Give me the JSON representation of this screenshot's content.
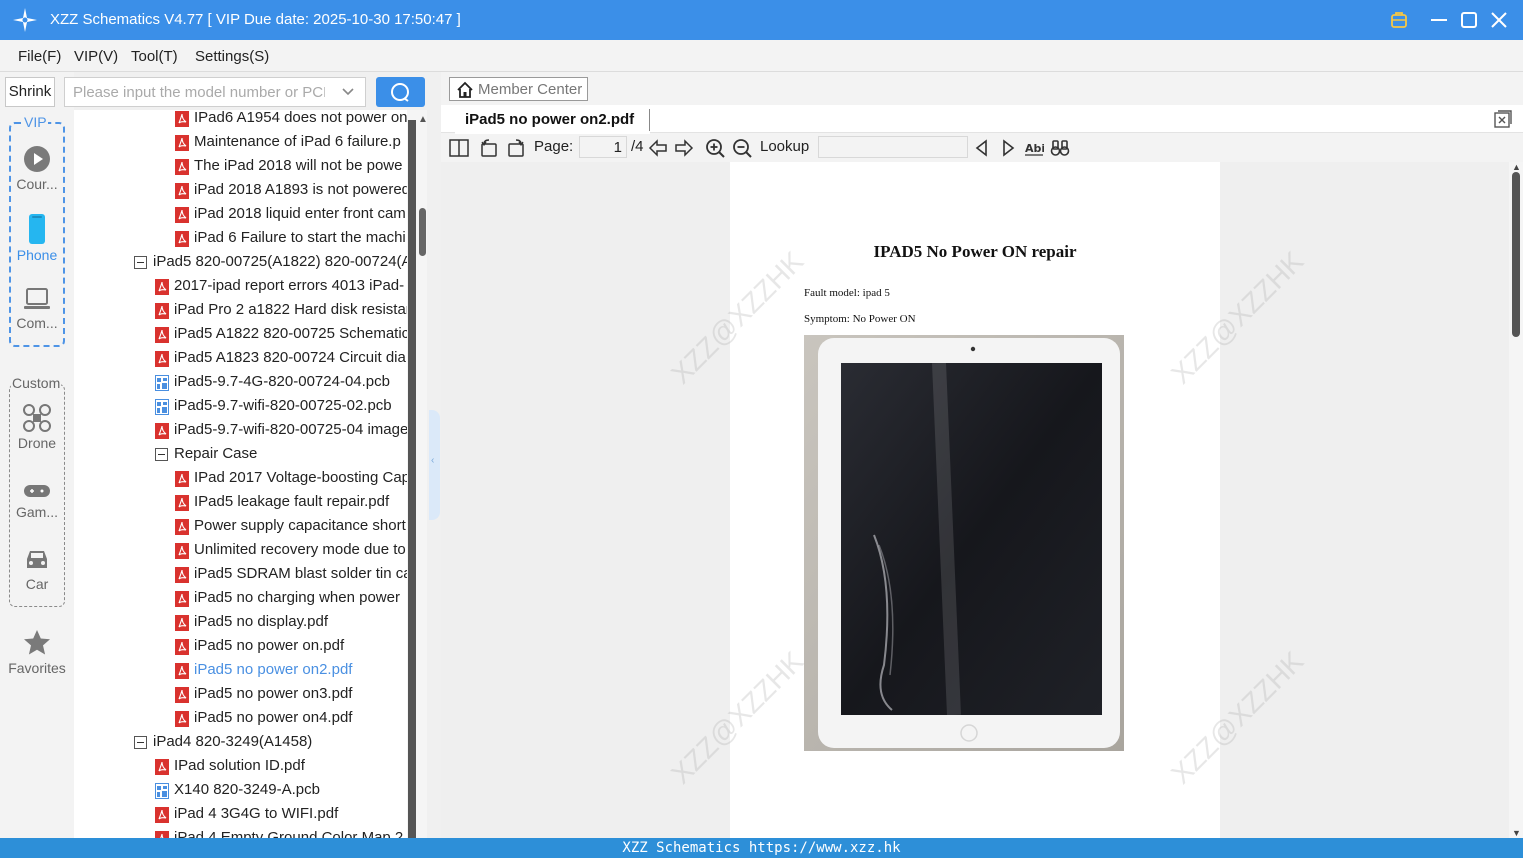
{
  "window": {
    "title": "XZZ Schematics V4.77 [ VIP Due date: 2025-10-30 17:50:47 ]"
  },
  "menu": [
    "File(F)",
    "VIP(V)",
    "Tool(T)",
    "Settings(S)"
  ],
  "left": {
    "shrink_label": "Shrink",
    "vip_label": "VIP",
    "custom_label": "Custom",
    "vip_items": [
      {
        "label": "Cour...",
        "icon": "play-icon"
      },
      {
        "label": "Phone",
        "icon": "phone-icon"
      },
      {
        "label": "Com...",
        "icon": "laptop-icon"
      }
    ],
    "custom_items": [
      {
        "label": "Drone",
        "icon": "drone-icon"
      },
      {
        "label": "Gam...",
        "icon": "gamepad-icon"
      },
      {
        "label": "Car",
        "icon": "car-icon"
      }
    ],
    "favorites_label": "Favorites"
  },
  "search": {
    "placeholder": "Please input the model number or PCB"
  },
  "tree": [
    {
      "label": "IPad6 A1954 does not power on",
      "type": "pdf",
      "level": 2
    },
    {
      "label": "Maintenance of iPad 6 failure.p",
      "type": "pdf",
      "level": 2
    },
    {
      "label": "The iPad 2018 will not be powe",
      "type": "pdf",
      "level": 2
    },
    {
      "label": "iPad 2018 A1893 is not powered",
      "type": "pdf",
      "level": 2
    },
    {
      "label": "iPad 2018 liquid enter front cam",
      "type": "pdf",
      "level": 2
    },
    {
      "label": "iPad 6 Failure to start the machi",
      "type": "pdf",
      "level": 2
    },
    {
      "label": "iPad5 820-00725(A1822) 820-00724(A",
      "type": "folder",
      "level": 0
    },
    {
      "label": "2017-ipad report errors 4013 iPad-",
      "type": "pdf",
      "level": 1
    },
    {
      "label": "iPad Pro 2 a1822 Hard disk resistar",
      "type": "pdf",
      "level": 1
    },
    {
      "label": "iPad5 A1822 820-00725 Schematic",
      "type": "pdf",
      "level": 1
    },
    {
      "label": "iPad5 A1823 820-00724 Circuit dia",
      "type": "pdf",
      "level": 1
    },
    {
      "label": "iPad5-9.7-4G-820-00724-04.pcb",
      "type": "pcb",
      "level": 1
    },
    {
      "label": "iPad5-9.7-wifi-820-00725-02.pcb",
      "type": "pcb",
      "level": 1
    },
    {
      "label": "iPad5-9.7-wifi-820-00725-04 image",
      "type": "pdf",
      "level": 1
    },
    {
      "label": "Repair Case",
      "type": "folder",
      "level": 1
    },
    {
      "label": "IPad 2017 Voltage-boosting Cap",
      "type": "pdf",
      "level": 2
    },
    {
      "label": "IPad5 leakage fault repair.pdf",
      "type": "pdf",
      "level": 2
    },
    {
      "label": "Power supply capacitance short",
      "type": "pdf",
      "level": 2
    },
    {
      "label": "Unlimited recovery mode due to",
      "type": "pdf",
      "level": 2
    },
    {
      "label": "iPad5 SDRAM blast solder tin ca",
      "type": "pdf",
      "level": 2
    },
    {
      "label": "iPad5 no charging when power",
      "type": "pdf",
      "level": 2
    },
    {
      "label": "iPad5 no display.pdf",
      "type": "pdf",
      "level": 2
    },
    {
      "label": "iPad5 no power on.pdf",
      "type": "pdf",
      "level": 2
    },
    {
      "label": "iPad5 no power on2.pdf",
      "type": "pdf",
      "level": 2,
      "selected": true
    },
    {
      "label": "iPad5 no power on3.pdf",
      "type": "pdf",
      "level": 2
    },
    {
      "label": "iPad5 no power on4.pdf",
      "type": "pdf",
      "level": 2
    },
    {
      "label": "iPad4 820-3249(A1458)",
      "type": "folder",
      "level": 0
    },
    {
      "label": "IPad solution ID.pdf",
      "type": "pdf",
      "level": 1
    },
    {
      "label": "X140 820-3249-A.pcb",
      "type": "pcb",
      "level": 1
    },
    {
      "label": "iPad 4 3G4G to WIFI.pdf",
      "type": "pdf",
      "level": 1
    },
    {
      "label": "iPad 4 Empty Ground Color Map 2",
      "type": "pdf",
      "level": 1
    }
  ],
  "viewer": {
    "member_center": "Member Center",
    "tab_title": "iPad5 no power on2.pdf",
    "page_label": "Page:",
    "page_current": "1",
    "page_total": "/4",
    "lookup_label": "Lookup",
    "lookup_value": ""
  },
  "document": {
    "title": "IPAD5 No Power ON repair",
    "fault_model": "Fault model: ipad 5",
    "symptom": "Symptom: No Power ON",
    "watermark": "XZZ@XZZHK"
  },
  "status": {
    "text": "XZZ Schematics https://www.xzz.hk"
  },
  "colors": {
    "accent": "#3b8fe8",
    "status_bar": "#2d8fd8",
    "pdf_icon": "#d9322e",
    "pcb_icon": "#4a8fe0",
    "selected_text": "#4a90e2"
  }
}
